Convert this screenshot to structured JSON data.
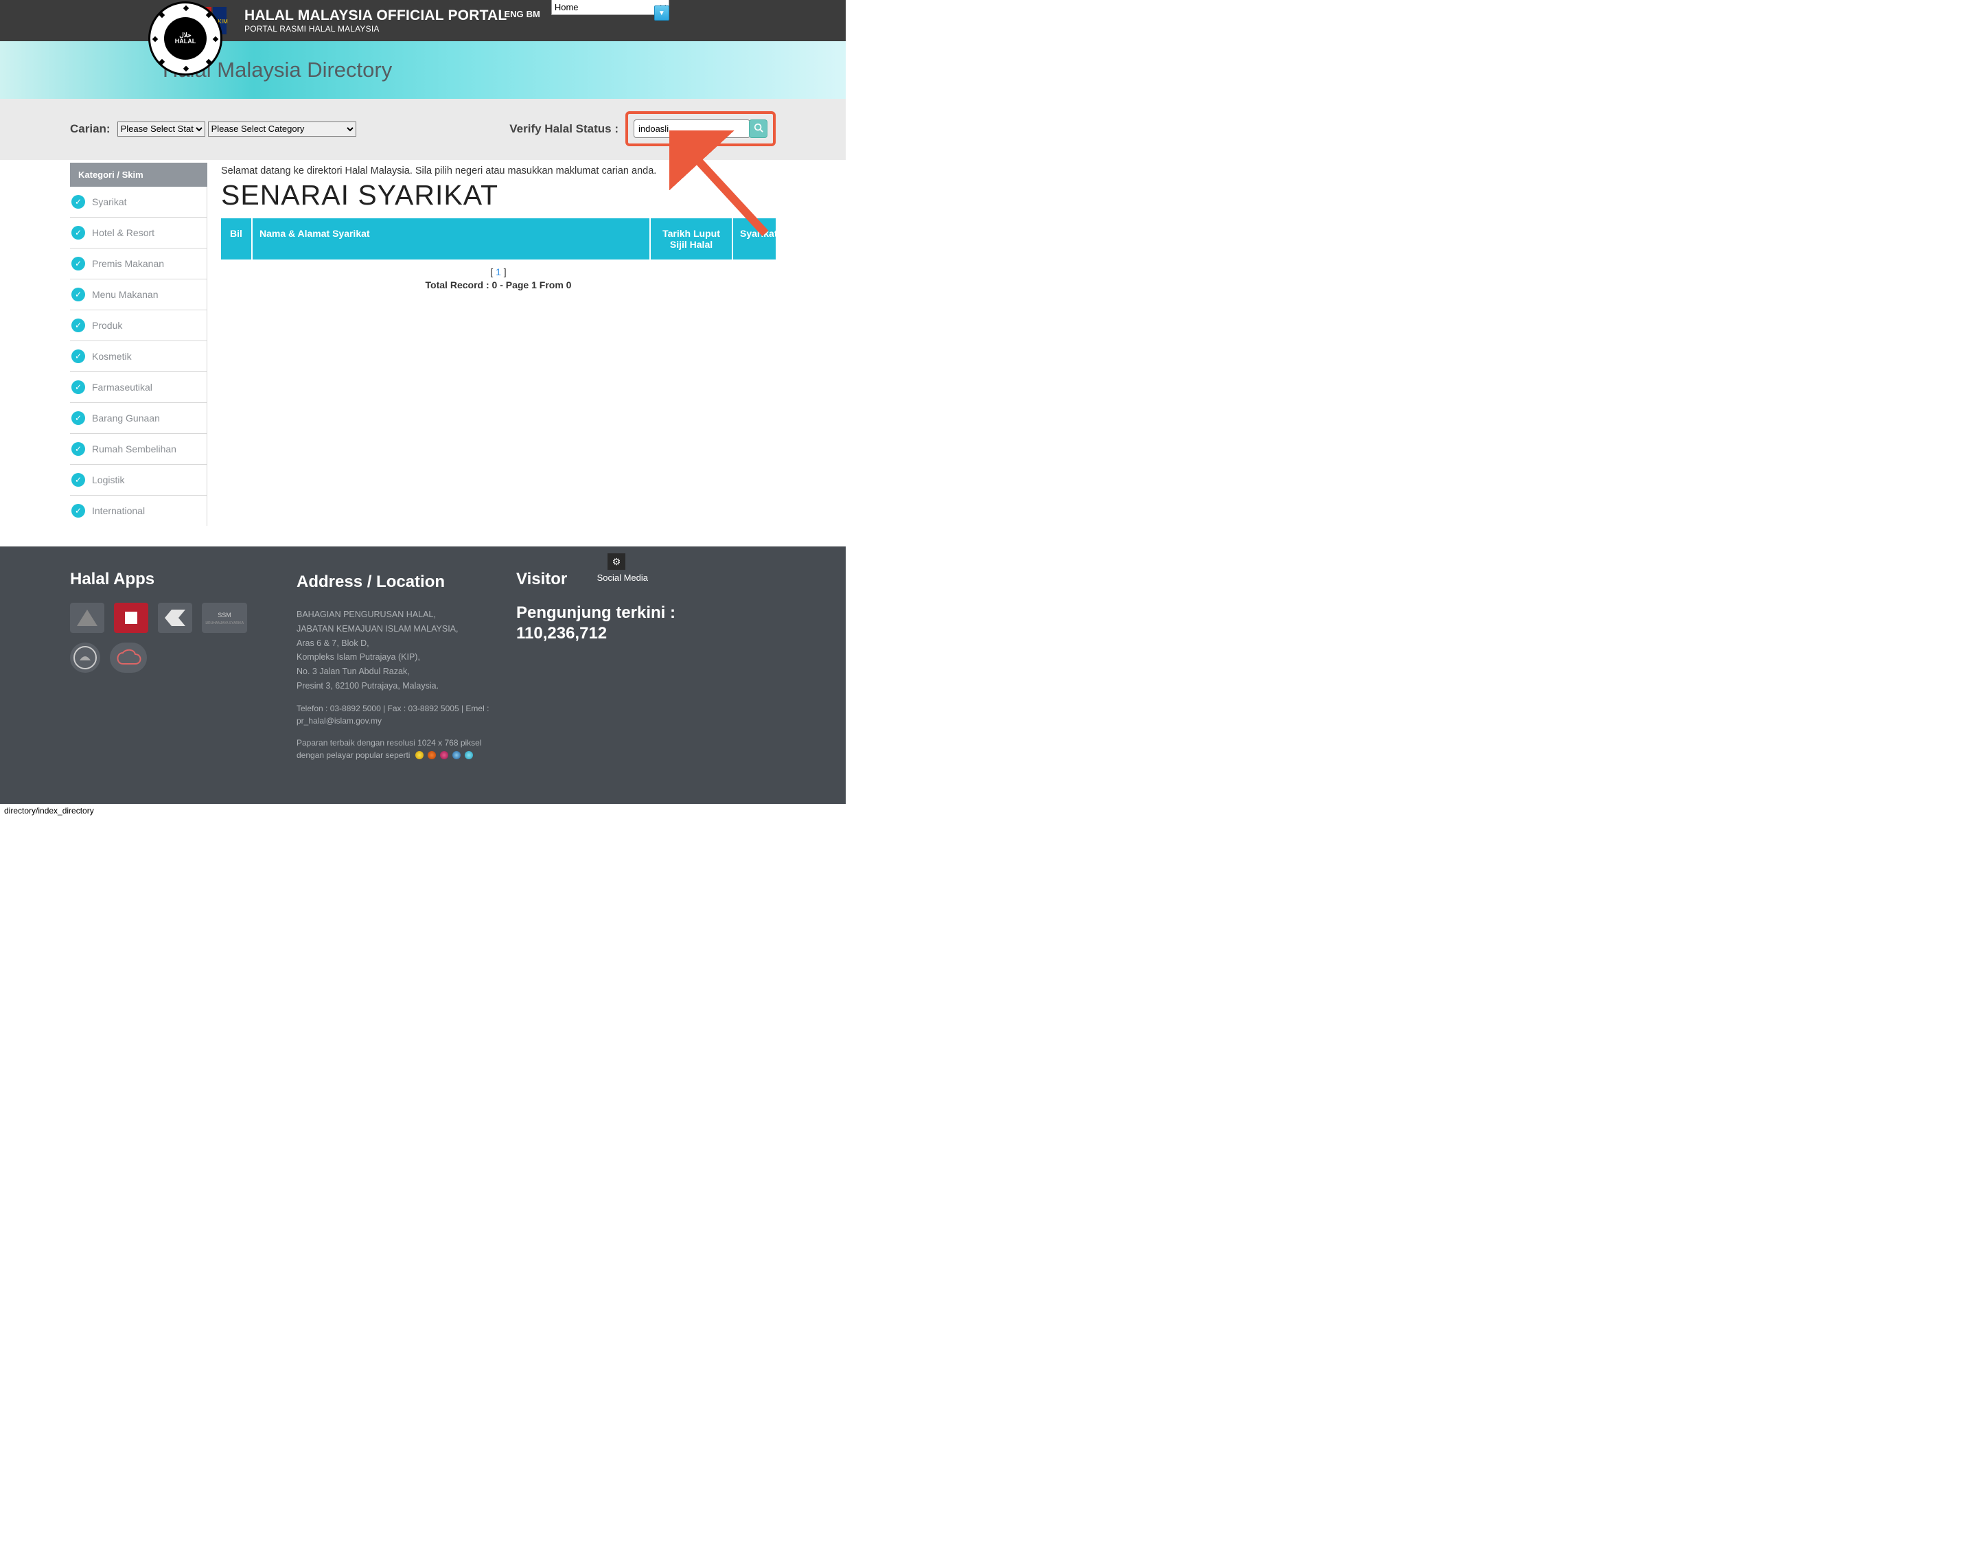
{
  "colors": {
    "accent": "#1dbcd6",
    "annotation": "#eb5a3c"
  },
  "header": {
    "title": "HALAL MALAYSIA OFFICIAL PORTAL",
    "subtitle": "PORTAL RASMI HALAL MALAYSIA",
    "lang_eng": "ENG",
    "lang_bm": "BM",
    "nav_selected": "Home"
  },
  "banner": {
    "title": "Halal Malaysia Directory"
  },
  "filter": {
    "search_label": "Carian:",
    "state_placeholder": "Please Select State",
    "category_placeholder": "Please Select Category",
    "verify_label": "Verify Halal Status :",
    "search_value": "indoasli"
  },
  "sidebar": {
    "header": "Kategori / Skim",
    "items": [
      {
        "label": "Syarikat"
      },
      {
        "label": "Hotel & Resort"
      },
      {
        "label": "Premis Makanan"
      },
      {
        "label": "Menu Makanan"
      },
      {
        "label": "Produk"
      },
      {
        "label": "Kosmetik"
      },
      {
        "label": "Farmaseutikal"
      },
      {
        "label": "Barang Gunaan"
      },
      {
        "label": "Rumah Sembelihan"
      },
      {
        "label": "Logistik"
      },
      {
        "label": "International"
      }
    ]
  },
  "main": {
    "welcome": "Selamat datang ke direktori Halal Malaysia. Sila pilih negeri atau masukkan maklumat carian anda.",
    "list_title": "SENARAI SYARIKAT",
    "columns": {
      "bil": "Bil",
      "nama": "Nama & Alamat Syarikat",
      "tarikh": "Tarikh Luput Sijil Halal",
      "syarikat": "Syarikat"
    },
    "pager_open": "[ ",
    "pager_num": "1",
    "pager_close": " ]",
    "record_info": "Total Record : 0 - Page 1 From 0"
  },
  "settings": {
    "social_label": "Social Media"
  },
  "footer": {
    "apps_title": "Halal Apps",
    "addr_title": "Address / Location",
    "visitor_title": "Visitor",
    "addr_lines": [
      "BAHAGIAN PENGURUSAN HALAL,",
      "JABATAN KEMAJUAN ISLAM MALAYSIA,",
      "Aras 6 & 7, Blok D,",
      "Kompleks Islam Putrajaya (KIP),",
      "No. 3 Jalan Tun Abdul Razak,",
      "Presint 3, 62100 Putrajaya, Malaysia."
    ],
    "contact_line": "Telefon : 03-8892 5000 | Fax : 03-8892 5005 | Emel : pr_halal@islam.gov.my",
    "resolution_line": "Paparan terbaik dengan resolusi 1024 x 768 piksel dengan pelayar popular seperti",
    "visitor_line1": "Pengunjung terkini :",
    "visitor_count": "110,236,712"
  },
  "status": {
    "path": "directory/index_directory"
  }
}
